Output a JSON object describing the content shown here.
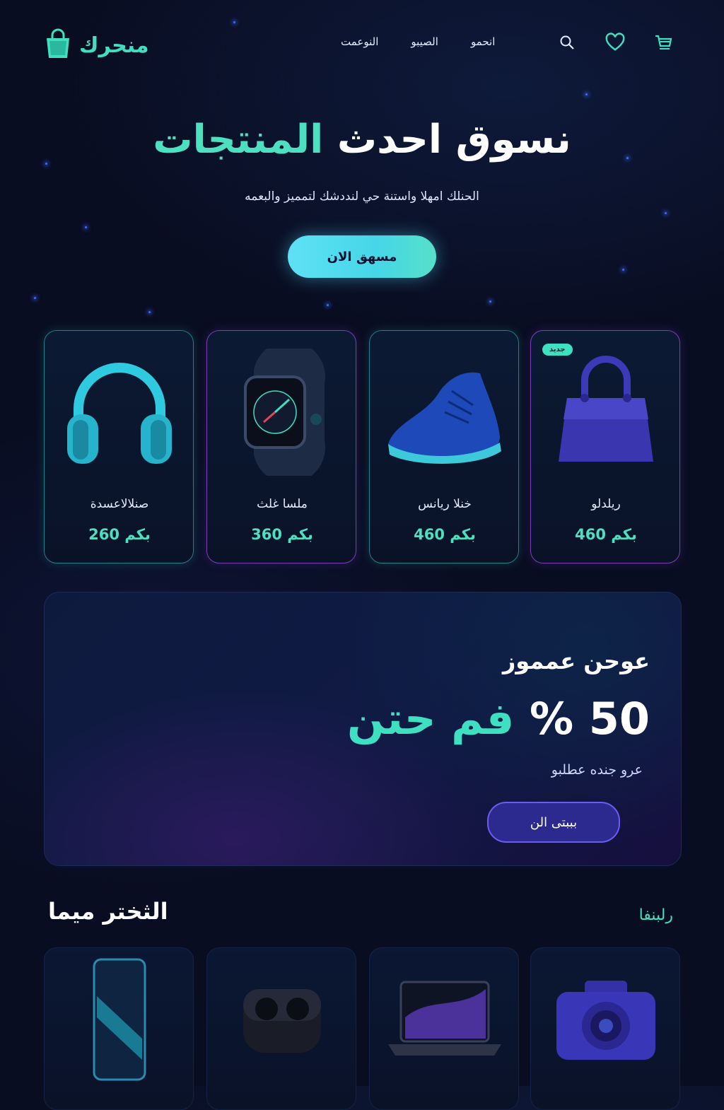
{
  "brand": {
    "name": "منحرك"
  },
  "nav": {
    "items": [
      "النوعمت",
      "الصيبو",
      "انحمو"
    ]
  },
  "hero": {
    "title_main": "نسوق احدث",
    "title_accent": "المنتجات",
    "subtitle": "الحنلك امهلا واستنة حي لنددشك لتمميز والبعمه",
    "cta": "مسهق الان"
  },
  "products": [
    {
      "name": "صنلالاعسدة",
      "price": "260 بكم"
    },
    {
      "name": "ملسا غلث",
      "price": "360 بكم"
    },
    {
      "name": "خنلا ريانس",
      "price": "460 بكم"
    },
    {
      "name": "ريلدلو",
      "price": "460 بكم",
      "badge": "جديد"
    }
  ],
  "promo": {
    "kicker": "عوحن عمموز",
    "big_num": "50 %",
    "big_accent": "فم حتن",
    "note": "عرو جنده عطلبو",
    "cta": "بببتى الن"
  },
  "section": {
    "title": "الثختر ميما",
    "link": "رلبنفا"
  },
  "colors": {
    "accent": "#3fe0c2",
    "background": "#090d22",
    "purple": "#6a5cf0"
  }
}
